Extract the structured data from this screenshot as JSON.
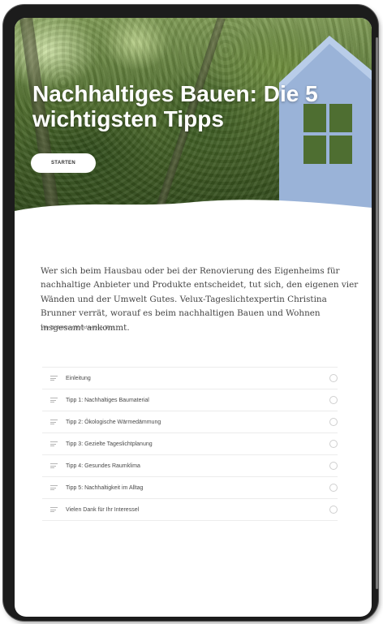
{
  "hero": {
    "title": "Nachhaltiges Bauen: Die 5 wichtigsten Tipps",
    "start_label": "STARTEN"
  },
  "intro": {
    "text": "Wer sich beim Hausbau oder bei der Renovierung des Eigenheims für nachhaltige Anbieter und Produkte entscheidet, tut sich, den eigenen vier Wänden und der Umwelt Gutes. Velux-Tageslichtexpertin Christina Brunner verrät, worauf es beim nachhaltigen Bauen und Wohnen insgesamt ankommt.",
    "byline": "Von Redaktion Handwerk + Bau"
  },
  "toc": {
    "items": [
      {
        "label": "Einleitung"
      },
      {
        "label": "Tipp 1: Nachhaltiges Baumaterial"
      },
      {
        "label": "Tipp 2: Ökologische Wärmedämmung"
      },
      {
        "label": "Tipp 3: Gezielte Tageslichtplanung"
      },
      {
        "label": "Tipp 4: Gesundes Raumklima"
      },
      {
        "label": "Tipp 5: Nachhaltigkeit im Alltag"
      },
      {
        "label": "Vielen Dank für Ihr Interessel"
      }
    ]
  },
  "colors": {
    "device_frame": "#1c1c1c",
    "hero_green": "#4d6b2c",
    "sky_blue": "#9ab3d8",
    "text": "#444444"
  }
}
